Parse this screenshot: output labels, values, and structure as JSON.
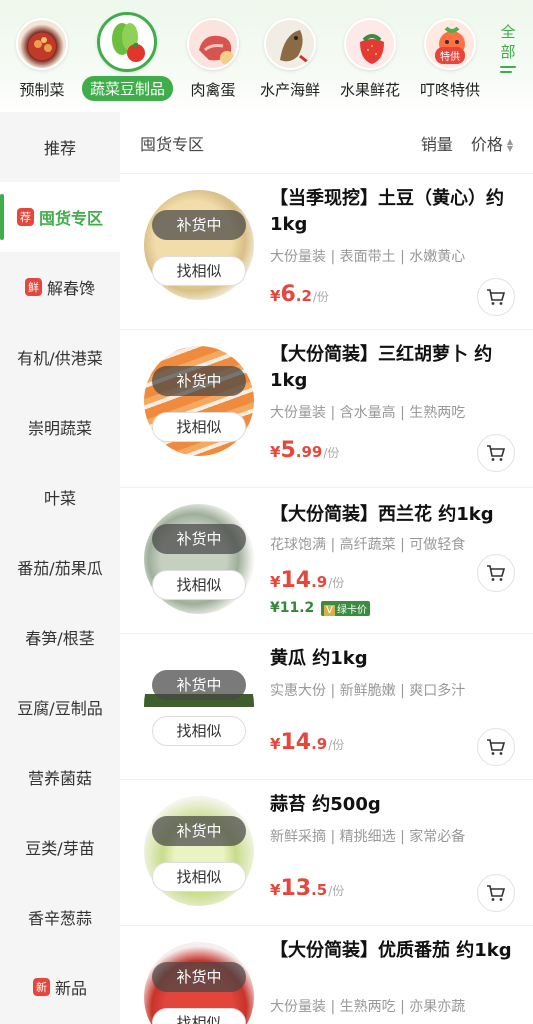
{
  "top_categories": [
    {
      "label": "预制菜",
      "icon": "prepared-dish-icon"
    },
    {
      "label": "蔬菜豆制品",
      "icon": "vegetable-icon"
    },
    {
      "label": "肉禽蛋",
      "icon": "meat-icon"
    },
    {
      "label": "水产海鲜",
      "icon": "seafood-icon"
    },
    {
      "label": "水果鲜花",
      "icon": "fruit-icon"
    },
    {
      "label": "叮咚特供",
      "icon": "special-offer-icon",
      "badge": "特供"
    }
  ],
  "all_button": {
    "label_line1": "全",
    "label_line2": "部"
  },
  "sidebar": {
    "items": [
      {
        "label": "推荐"
      },
      {
        "label": "囤货专区",
        "badge": "荐"
      },
      {
        "label": "解春馋",
        "badge": "鲜"
      },
      {
        "label": "有机/供港菜"
      },
      {
        "label": "崇明蔬菜"
      },
      {
        "label": "叶菜"
      },
      {
        "label": "番茄/茄果瓜"
      },
      {
        "label": "春笋/根茎"
      },
      {
        "label": "豆腐/豆制品"
      },
      {
        "label": "营养菌菇"
      },
      {
        "label": "豆类/芽苗"
      },
      {
        "label": "香辛葱蒜"
      },
      {
        "label": "新品",
        "badge": "新"
      }
    ]
  },
  "sortbar": {
    "section_title": "囤货专区",
    "sales": "销量",
    "price": "价格"
  },
  "products": [
    {
      "name": "【当季现挖】土豆（黄心）约1kg",
      "desc": "大份量装 | 表面带土 | 水嫩黄心",
      "status": "补货中",
      "similar": "找相似",
      "currency": "¥",
      "price_int": "6",
      "price_dec": ".2",
      "unit": "/份"
    },
    {
      "name": "【大份简装】三红胡萝卜 约1kg",
      "desc": "大份量装 | 含水量高 | 生熟两吃",
      "status": "补货中",
      "similar": "找相似",
      "currency": "¥",
      "price_int": "5",
      "price_dec": ".99",
      "unit": "/份"
    },
    {
      "name": "【大份简装】西兰花 约1kg",
      "desc": "花球饱满 | 高纤蔬菜 | 可做轻食",
      "status": "补货中",
      "similar": "找相似",
      "currency": "¥",
      "price_int": "14",
      "price_dec": ".9",
      "unit": "/份",
      "member_price": "¥11.2",
      "member_tag": "绿卡价",
      "member_mark": "V"
    },
    {
      "name": "黄瓜 约1kg",
      "desc": "实惠大份 | 新鲜脆嫩 | 爽口多汁",
      "status": "补货中",
      "similar": "找相似",
      "currency": "¥",
      "price_int": "14",
      "price_dec": ".9",
      "unit": "/份"
    },
    {
      "name": "蒜苔 约500g",
      "desc": "新鲜采摘 | 精挑细选 | 家常必备",
      "status": "补货中",
      "similar": "找相似",
      "currency": "¥",
      "price_int": "13",
      "price_dec": ".5",
      "unit": "/份"
    },
    {
      "name": "【大份简装】优质番茄 约1kg",
      "desc": "大份量装 | 生熟两吃 | 亦果亦蔬",
      "status": "补货中",
      "similar": "找相似"
    }
  ],
  "colors": {
    "accent": "#3fae4a",
    "price": "#e5473c",
    "member": "#2f8a36"
  }
}
